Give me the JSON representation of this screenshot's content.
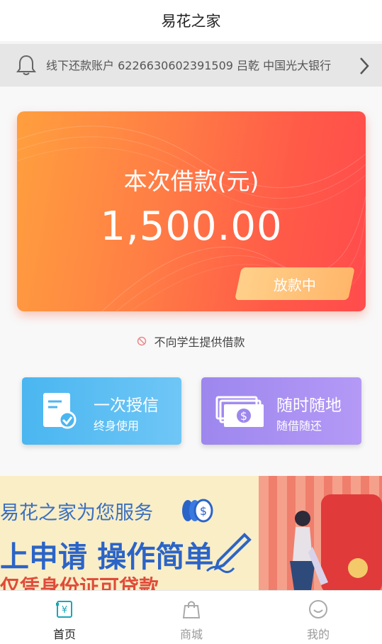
{
  "header": {
    "title": "易花之家"
  },
  "notice": {
    "text": "线下还款账户 6226630602391509 吕乾 中国光大银行",
    "icon": "bell-icon"
  },
  "loan_card": {
    "title": "本次借款(元)",
    "amount": "1,500.00",
    "status_label": "放款中",
    "gradient_colors": [
      "#ff9f3e",
      "#ff4b4c"
    ]
  },
  "student_note": {
    "text": "不向学生提供借款"
  },
  "features": [
    {
      "title": "一次授信",
      "subtitle": "终身使用",
      "color": "#4ab6f0",
      "icon": "document-check-icon"
    },
    {
      "title": "随时随地",
      "subtitle": "随借随还",
      "color": "#9d87ee",
      "icon": "money-bills-icon"
    }
  ],
  "banner": {
    "line1": "易花之家为您服务",
    "line2": "上申请  操作简单",
    "line3": "仅凭身份证可贷款"
  },
  "tabbar": {
    "items": [
      {
        "label": "首页",
        "icon": "home-yuan-icon",
        "active": true
      },
      {
        "label": "商城",
        "icon": "shopping-bag-icon",
        "active": false
      },
      {
        "label": "我的",
        "icon": "profile-smile-icon",
        "active": false
      }
    ]
  }
}
